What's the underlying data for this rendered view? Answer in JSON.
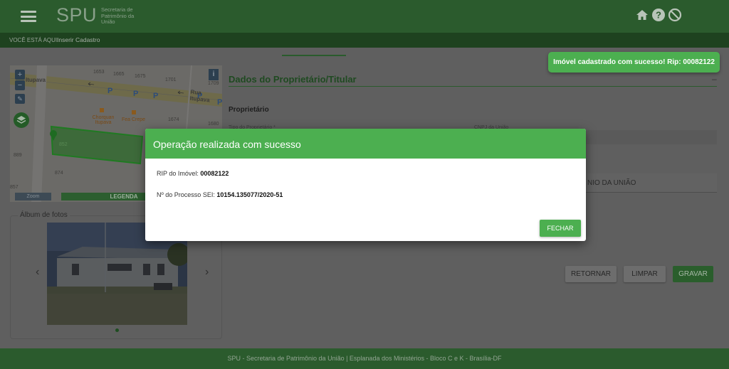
{
  "header": {
    "logo": "SPU",
    "logo_subtitle": "Secretaria de Patrimônio da União",
    "icons": [
      "home-icon",
      "help-icon",
      "block-icon"
    ]
  },
  "breadcrumb": {
    "label": "VOCÊ ESTÁ AQUI:",
    "current": "Inserir Cadastro"
  },
  "map": {
    "street_name": "Rua Itupava",
    "street_name_left": "Itupava",
    "lot_numbers": [
      "1653",
      "1665",
      "1675",
      "1701",
      "1709",
      "1674",
      "1680",
      "852",
      "889",
      "874",
      "857"
    ],
    "places": [
      "Chorquan Itupava",
      "Fea Crepe"
    ],
    "zoom_plus": "+",
    "zoom_minus": "−",
    "info": "i",
    "zoom_label": "Zoom",
    "legend_label": "LEGENDA"
  },
  "album": {
    "title": "Álbum de fotos",
    "prev": "‹",
    "next": "›"
  },
  "form": {
    "section_title": "Dados do Proprietário/Titular",
    "collapse": "–",
    "subsection": "Proprietário",
    "field1_label": "Tipo do Proprietário *",
    "field2_label": "CNPJ da União",
    "field_value": "NIO DA UNIÃO"
  },
  "actions": {
    "retornar": "RETORNAR",
    "limpar": "LIMPAR",
    "gravar": "GRAVAR"
  },
  "footer": {
    "text": "SPU - Secretaria de Patrimônio da União | Esplanada dos Ministérios - Bloco C e K - Brasília-DF"
  },
  "toast": {
    "message": "Imóvel cadastrado com sucesso! Rip: 00082122"
  },
  "modal": {
    "title": "Operação realizada com sucesso",
    "rip_label": "RIP do Imóvel:",
    "rip_value": "00082122",
    "sei_label": "Nº do Processo SEI:",
    "sei_value": "10154.135077/2020-51",
    "close_button": "FECHAR"
  },
  "colors": {
    "primary_green": "#4caf50",
    "header_green": "#2b5b2d"
  }
}
